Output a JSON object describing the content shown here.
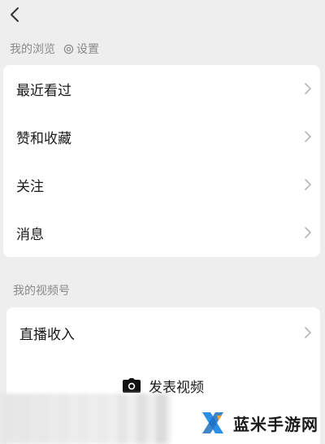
{
  "nav": {
    "back_icon": "chevron-left-icon"
  },
  "browse": {
    "header": "我的浏览",
    "settings_label": "设置",
    "settings_icon": "gear-icon",
    "items": [
      {
        "label": "最近看过"
      },
      {
        "label": "赞和收藏"
      },
      {
        "label": "关注"
      },
      {
        "label": "消息"
      }
    ]
  },
  "channel": {
    "header": "我的视频号",
    "items": [
      {
        "label": "直播收入"
      }
    ],
    "publish_label": "发表视频",
    "publish_icon": "camera-icon"
  },
  "watermark": {
    "text": "蓝米手游网",
    "accent": "#2b8fe8"
  }
}
